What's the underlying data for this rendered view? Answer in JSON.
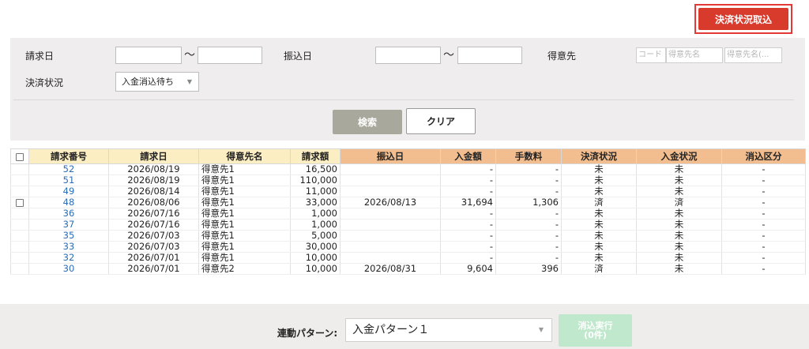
{
  "toolbar": {
    "import_label": "決済状況取込"
  },
  "search": {
    "billing_date_label": "請求日",
    "transfer_date_label": "振込日",
    "customer_label": "得意先",
    "status_label": "決済状況",
    "range_sep": "～",
    "status_value": "入金消込待ち",
    "customer_code_placeholder": "コード",
    "customer_name_placeholder": "得意先名",
    "customer_name2_placeholder": "得意先名(...",
    "search_button": "検索",
    "clear_button": "クリア"
  },
  "table": {
    "headers": [
      "請求番号",
      "請求日",
      "得意先名",
      "請求額",
      "振込日",
      "入金額",
      "手数料",
      "決済状況",
      "入金状況",
      "消込区分"
    ],
    "rows": [
      {
        "checkbox": false,
        "id": "52",
        "billing_date": "2026/08/19",
        "customer": "得意先1",
        "amount": "16,500",
        "transfer_date": "",
        "deposit": "-",
        "fee": "-",
        "settle": "未",
        "deposit_status": "未",
        "clear": "-"
      },
      {
        "checkbox": false,
        "id": "51",
        "billing_date": "2026/08/19",
        "customer": "得意先1",
        "amount": "110,000",
        "transfer_date": "",
        "deposit": "-",
        "fee": "-",
        "settle": "未",
        "deposit_status": "未",
        "clear": "-"
      },
      {
        "checkbox": false,
        "id": "49",
        "billing_date": "2026/08/14",
        "customer": "得意先1",
        "amount": "11,000",
        "transfer_date": "",
        "deposit": "-",
        "fee": "-",
        "settle": "未",
        "deposit_status": "未",
        "clear": "-"
      },
      {
        "checkbox": true,
        "id": "48",
        "billing_date": "2026/08/06",
        "customer": "得意先1",
        "amount": "33,000",
        "transfer_date": "2026/08/13",
        "deposit": "31,694",
        "fee": "1,306",
        "settle": "済",
        "deposit_status": "済",
        "clear": "-"
      },
      {
        "checkbox": false,
        "id": "36",
        "billing_date": "2026/07/16",
        "customer": "得意先1",
        "amount": "1,000",
        "transfer_date": "",
        "deposit": "-",
        "fee": "-",
        "settle": "未",
        "deposit_status": "未",
        "clear": "-"
      },
      {
        "checkbox": false,
        "id": "37",
        "billing_date": "2026/07/16",
        "customer": "得意先1",
        "amount": "1,000",
        "transfer_date": "",
        "deposit": "-",
        "fee": "-",
        "settle": "未",
        "deposit_status": "未",
        "clear": "-"
      },
      {
        "checkbox": false,
        "id": "35",
        "billing_date": "2026/07/03",
        "customer": "得意先1",
        "amount": "5,000",
        "transfer_date": "",
        "deposit": "-",
        "fee": "-",
        "settle": "未",
        "deposit_status": "未",
        "clear": "-"
      },
      {
        "checkbox": false,
        "id": "33",
        "billing_date": "2026/07/03",
        "customer": "得意先1",
        "amount": "30,000",
        "transfer_date": "",
        "deposit": "-",
        "fee": "-",
        "settle": "未",
        "deposit_status": "未",
        "clear": "-"
      },
      {
        "checkbox": false,
        "id": "32",
        "billing_date": "2026/07/01",
        "customer": "得意先1",
        "amount": "10,000",
        "transfer_date": "",
        "deposit": "-",
        "fee": "-",
        "settle": "未",
        "deposit_status": "未",
        "clear": "-"
      },
      {
        "checkbox": false,
        "id": "30",
        "billing_date": "2026/07/01",
        "customer": "得意先2",
        "amount": "10,000",
        "transfer_date": "2026/08/31",
        "deposit": "9,604",
        "fee": "396",
        "settle": "済",
        "deposit_status": "未",
        "clear": "-"
      }
    ]
  },
  "footer": {
    "pattern_label": "連動パターン:",
    "pattern_value": "入金パターン１",
    "exec_label": "消込実行",
    "exec_count": "(0件)"
  },
  "colors": {
    "import_button": "#d83a2b",
    "header_yellow": "#fbeec2",
    "header_orange": "#f3be8f",
    "link": "#2b6db5"
  }
}
